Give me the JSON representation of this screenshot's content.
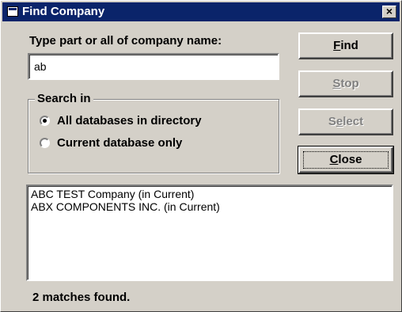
{
  "window": {
    "title": "Find Company",
    "close_label": "×"
  },
  "search": {
    "prompt_label": "Type part or all of company name:",
    "value": "ab",
    "placeholder": ""
  },
  "search_in": {
    "title": "Search in",
    "options": [
      {
        "label": "All databases in directory",
        "selected": true
      },
      {
        "label": "Current database only",
        "selected": false
      }
    ]
  },
  "buttons": {
    "find": {
      "pre": "",
      "accel": "F",
      "post": "ind",
      "enabled": true
    },
    "stop": {
      "pre": "",
      "accel": "S",
      "post": "top",
      "enabled": false
    },
    "select": {
      "pre": "S",
      "accel": "e",
      "post": "lect",
      "enabled": false
    },
    "close": {
      "pre": "",
      "accel": "C",
      "post": "lose",
      "enabled": true
    }
  },
  "results": [
    "ABC TEST Company (in Current)",
    "ABX COMPONENTS INC. (in Current)"
  ],
  "status": "2 matches found.",
  "colors": {
    "titlebar": "#0a246a",
    "face": "#d4d0c8"
  }
}
